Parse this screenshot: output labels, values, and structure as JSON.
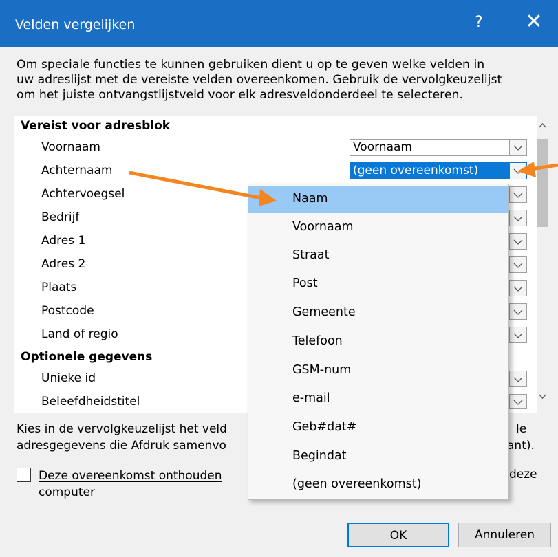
{
  "window": {
    "title": "Velden vergelijken",
    "help": "?",
    "close": "✕"
  },
  "intro": [
    "Om speciale functies te kunnen gebruiken dient u op te geven welke velden in",
    "uw adreslijst met de vereiste velden overeenkomen. Gebruik de vervolgkeuzelijst",
    "om het juiste ontvangstlijstveld voor elk adresveldonderdeel te selecteren."
  ],
  "sections": {
    "required": "Vereist voor adresblok",
    "optional": "Optionele gegevens"
  },
  "fields": [
    {
      "label": "Voornaam",
      "value": "Voornaam"
    },
    {
      "label": "Achternaam",
      "value": "(geen overeenkomst)"
    },
    {
      "label": "Achtervoegsel"
    },
    {
      "label": "Bedrijf"
    },
    {
      "label": "Adres 1"
    },
    {
      "label": "Adres 2"
    },
    {
      "label": "Plaats"
    },
    {
      "label": "Postcode"
    },
    {
      "label": "Land of regio"
    },
    {
      "label": "Unieke id"
    },
    {
      "label": "Beleefdheidstitel"
    }
  ],
  "below_text": {
    "line1": "Kies in de vervolgkeuzelijst het veld",
    "line2": "adresgegevens die Afdruk samenvo",
    "line1_end": "le",
    "line2_end": "ant)."
  },
  "checkbox": {
    "line1": "Deze overeenkomst onthouden",
    "line2": "computer",
    "end": "deze",
    "checked": false
  },
  "dropdown": {
    "items": [
      "Naam",
      "Voornaam",
      "Straat",
      "Post",
      "Gemeente",
      "Telefoon",
      "GSM-num",
      "e-mail",
      "Geb#dat#",
      "Begindat",
      "(geen overeenkomst)"
    ],
    "highlighted": "Naam"
  },
  "buttons": {
    "ok": "OK",
    "cancel": "Annuleren"
  },
  "colors": {
    "titlebar": "#1a6fc4",
    "selection": "#0a78d7",
    "highlight": "#99c9f5",
    "annotation_arrow": "#f5861f"
  }
}
